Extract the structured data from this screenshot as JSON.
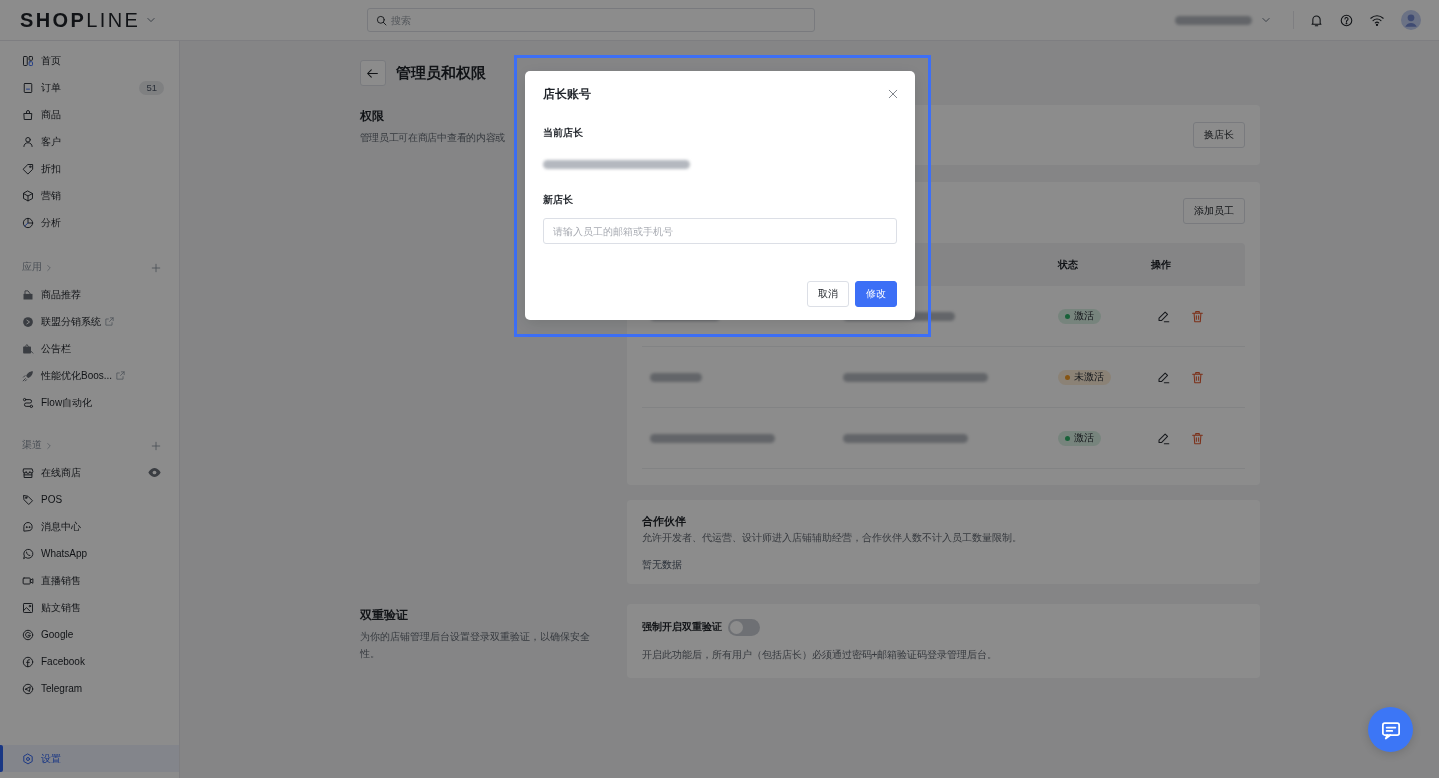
{
  "top_bar": {
    "logo": "**SHOP**LINE",
    "search": {
      "placeholder": "搜索"
    }
  },
  "sidebar": {
    "items": [
      {
        "label": "首页",
        "selected": false
      },
      {
        "label": "订单",
        "badge": "51",
        "selected": false
      },
      {
        "label": "商品",
        "selected": false
      },
      {
        "label": "客户",
        "selected": false
      },
      {
        "label": "折扣",
        "selected": false
      },
      {
        "label": "营销",
        "selected": false
      },
      {
        "label": "分析",
        "selected": false
      }
    ],
    "sections": [
      {
        "title": "应用",
        "items": [
          {
            "label": "商品推荐",
            "external": false,
            "selected": false
          },
          {
            "label": "联盟分销系统",
            "external": true,
            "selected": false
          },
          {
            "label": "公告栏",
            "external": false,
            "selected": false
          },
          {
            "label": "性能优化Boos...",
            "external": true,
            "selected": false
          },
          {
            "label": "Flow自动化",
            "external": false,
            "selected": false
          }
        ]
      },
      {
        "title": "渠道",
        "items": [
          {
            "label": "在线商店",
            "preview": true,
            "selected": false
          },
          {
            "label": "POS",
            "preview": false,
            "selected": false
          },
          {
            "label": "消息中心",
            "preview": false,
            "selected": false
          },
          {
            "label": "WhatsApp",
            "preview": false,
            "selected": false
          },
          {
            "label": "直播销售",
            "preview": false,
            "selected": false
          },
          {
            "label": "贴文销售",
            "preview": false,
            "selected": false
          },
          {
            "label": "Google",
            "preview": false,
            "selected": false
          },
          {
            "label": "Facebook",
            "preview": false,
            "selected": false
          },
          {
            "label": "Telegram",
            "preview": false,
            "selected": false
          }
        ]
      }
    ],
    "footer_items": [
      {
        "label": "设置",
        "selected": true
      }
    ]
  },
  "page": {
    "title": "管理员和权限",
    "permissions": {
      "title": "权限",
      "description": "管理员工可在商店中查看的内容或",
      "owner_card": {
        "button": "换店长"
      },
      "staff_card": {
        "button": "添加员工",
        "header": {
          "column_3": "状态",
          "column_4": "操作"
        },
        "rows": [
          {
            "status": "激活",
            "color": "#1a623a"
          },
          {
            "status": "未激活",
            "color": "#875513"
          },
          {
            "status": "激活",
            "color": "#1a623a"
          }
        ]
      }
    },
    "partners": {
      "title": "合作伙伴",
      "description": "允许开发者、代运营、设计师进入店铺辅助经营，合作伙伴人数不计入员工数量限制。",
      "empty_text": "暂无数据"
    },
    "two_factor": {
      "title": "双重验证",
      "description": "为你的店铺管理后台设置登录双重验证，以确保安全性。",
      "toggle": {
        "label": "强制开启双重验证",
        "on": false
      },
      "note": "开启此功能后，所有用户（包括店长）必须通过密码+邮箱验证码登录管理后台。"
    }
  },
  "modal": {
    "title": "店长账号",
    "current_label": "当前店长",
    "new_label": "新店长",
    "input": {
      "placeholder": "请输入员工的邮箱或手机号"
    },
    "buttons": [
      {
        "label": "取消",
        "primary": false
      },
      {
        "label": "修改",
        "primary": true
      }
    ]
  }
}
